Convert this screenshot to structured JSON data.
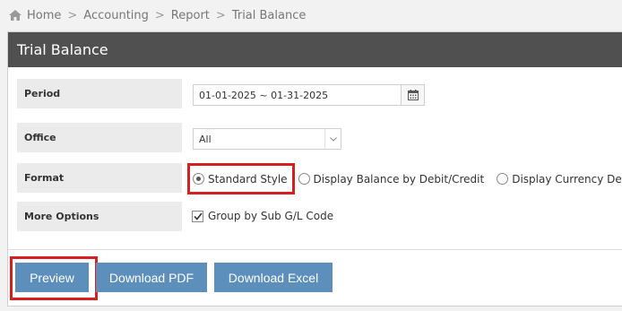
{
  "breadcrumb": {
    "home": "Home",
    "items": [
      "Accounting",
      "Report",
      "Trial Balance"
    ],
    "separator": ">"
  },
  "panel": {
    "title": "Trial Balance"
  },
  "form": {
    "period": {
      "label": "Period",
      "value": "01-01-2025 ~ 01-31-2025",
      "icon": "calendar-icon"
    },
    "office": {
      "label": "Office",
      "value": "All",
      "icon": "chevron-down-icon"
    },
    "format": {
      "label": "Format",
      "options": [
        "Standard Style",
        "Display Balance by Debit/Credit",
        "Display Currency Detail"
      ],
      "selected": "Standard Style"
    },
    "more_options": {
      "label": "More Options",
      "checkbox_label": "Group by Sub G/L Code",
      "checked": true
    }
  },
  "buttons": {
    "preview": "Preview",
    "download_pdf": "Download PDF",
    "download_excel": "Download Excel"
  },
  "colors": {
    "header_bg": "#505050",
    "button_bg": "#5d8fbd",
    "highlight": "#d62020",
    "label_bg": "#ebebeb"
  }
}
